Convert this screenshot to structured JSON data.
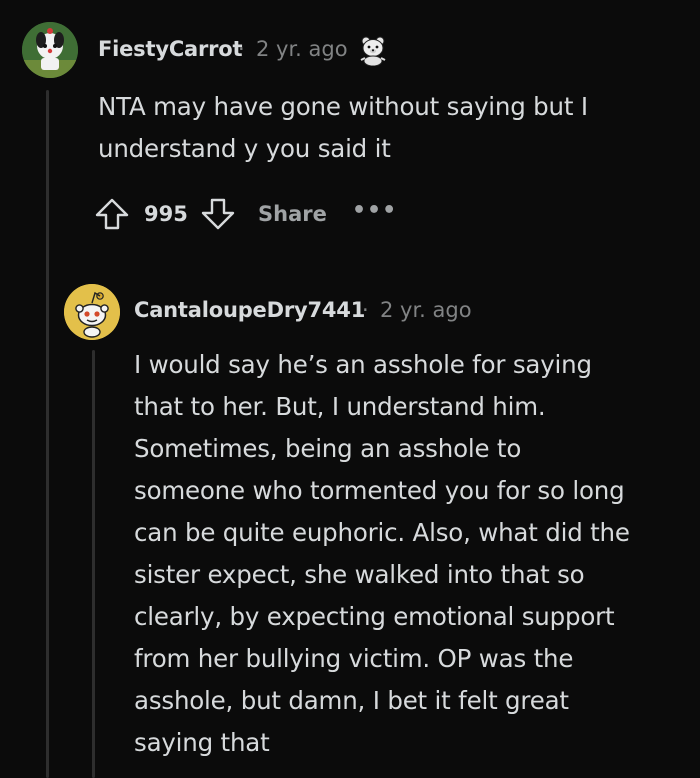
{
  "comments": [
    {
      "username": "FiestyCarrot",
      "time": "2 yr. ago",
      "separator": "·",
      "flair_icon": "bear-icon",
      "body": "NTA may have gone without saying but I\nunderstand y you said it",
      "score": "995",
      "share_label": "Share",
      "more_label": "•••"
    },
    {
      "username": "CantaloupeDry7441",
      "time": "2 yr. ago",
      "separator": "·",
      "body": "I would say he’s an asshole for saying\nthat to her. But, I understand him.\nSometimes, being an asshole to\nsomeone who tormented you for so long\ncan be quite euphoric. Also, what did the\nsister expect, she walked into that so\nclearly, by expecting emotional support\nfrom her bullying victim. OP was the\nasshole, but damn, I bet it felt great\nsaying that"
    }
  ],
  "colors": {
    "background": "#0b0b0b",
    "text": "#d7dadc",
    "meta": "#818384",
    "thread_line": "#2e2e2e",
    "snoo_avatar_bg": "#e3c04a"
  }
}
